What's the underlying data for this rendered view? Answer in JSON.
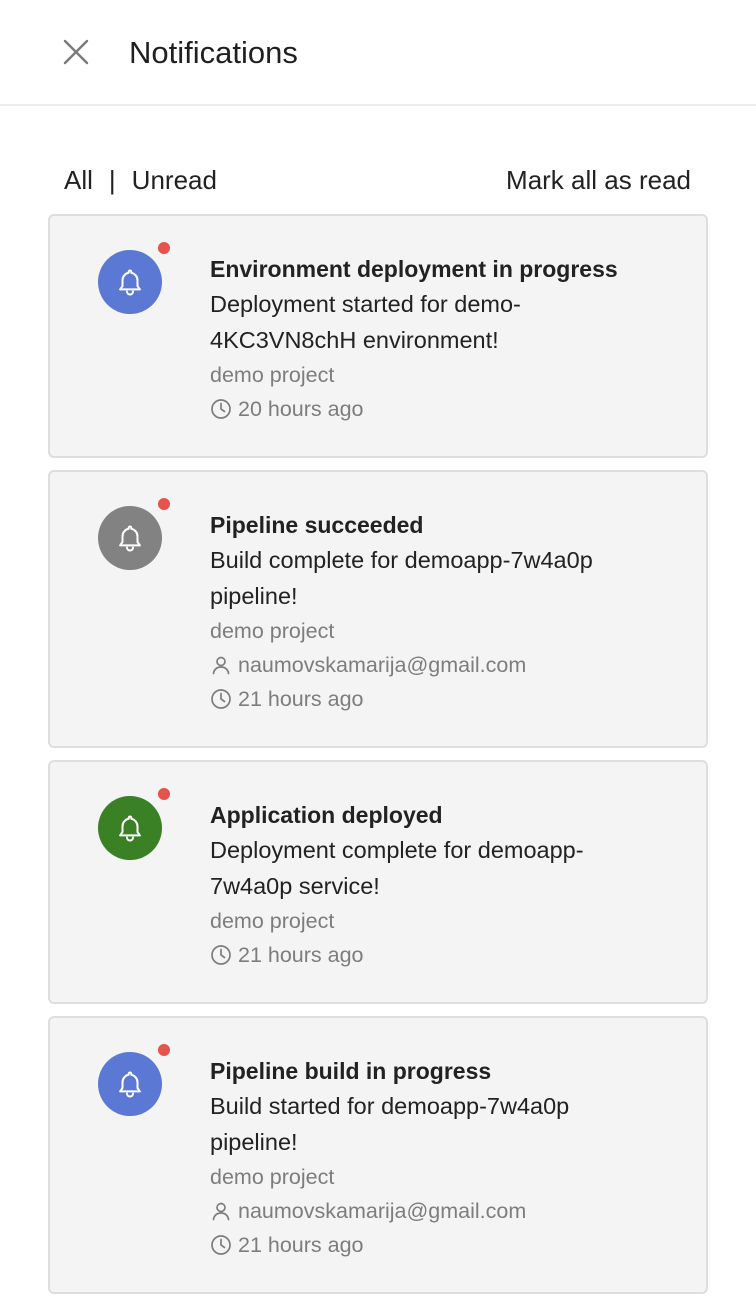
{
  "header": {
    "title": "Notifications",
    "close_icon": "close-icon"
  },
  "filters": {
    "all_label": "All",
    "separator": "|",
    "unread_label": "Unread",
    "mark_all_label": "Mark all as read"
  },
  "colors": {
    "blue": "#5b79d4",
    "gray": "#828282",
    "green": "#3a8126",
    "unread_dot": "#e5534b"
  },
  "notifications": [
    {
      "title": "Environment deployment in progress",
      "message_line1": "Deployment started for demo-",
      "message_line2": "4KC3VN8chH environment!",
      "project": "demo project",
      "time": "20 hours ago",
      "icon": "bell-icon",
      "icon_color": "#5b79d4"
    },
    {
      "title": "Pipeline succeeded",
      "message_line1": "Build complete for demoapp-7w4a0p",
      "message_line2": "pipeline!",
      "project": "demo project",
      "user": "naumovskamarija@gmail.com",
      "time": "21 hours ago",
      "icon": "bell-icon",
      "icon_color": "#828282"
    },
    {
      "title": "Application deployed",
      "message_line1": "Deployment complete for demoapp-",
      "message_line2": "7w4a0p service!",
      "project": "demo project",
      "time": "21 hours ago",
      "icon": "bell-icon",
      "icon_color": "#3a8126"
    },
    {
      "title": "Pipeline build in progress",
      "message_line1": "Build started for demoapp-7w4a0p",
      "message_line2": "pipeline!",
      "project": "demo project",
      "user": "naumovskamarija@gmail.com",
      "time": "21 hours ago",
      "icon": "bell-icon",
      "icon_color": "#5b79d4"
    }
  ]
}
